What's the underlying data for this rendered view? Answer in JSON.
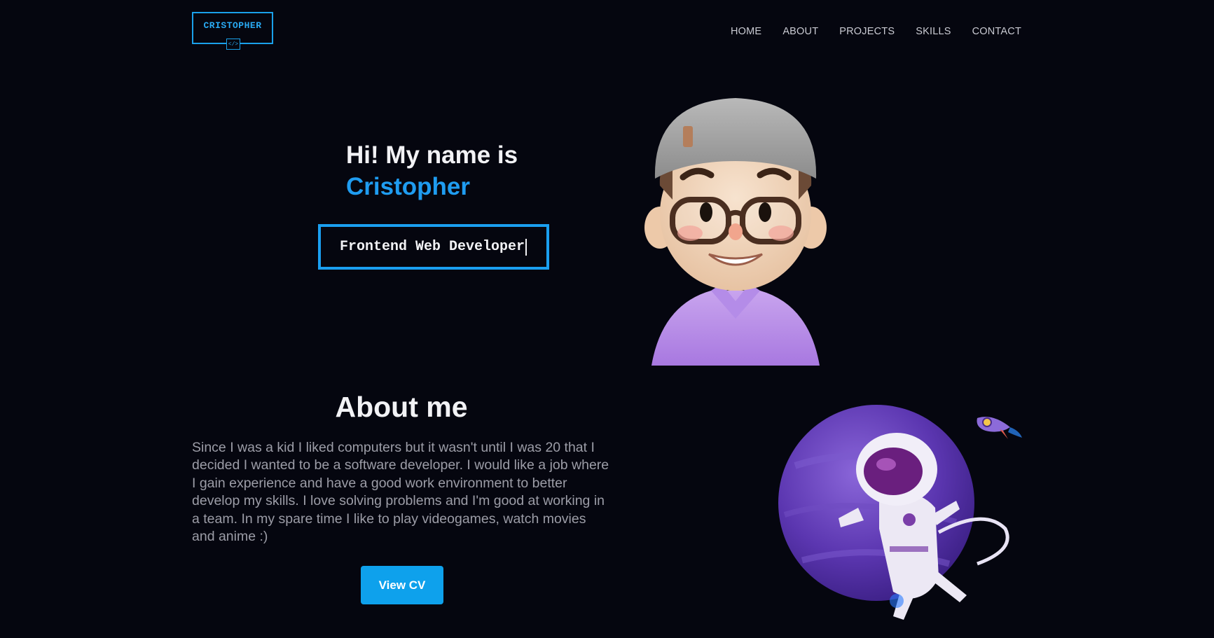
{
  "nav": {
    "logo_text": "CRISTOPHER",
    "logo_code": "</>",
    "links": [
      "HOME",
      "ABOUT",
      "PROJECTS",
      "SKILLS",
      "CONTACT"
    ]
  },
  "hero": {
    "greeting": "Hi! My name is",
    "name": "Cristopher",
    "role": "Frontend Web Developer"
  },
  "about": {
    "title": "About me",
    "text": "Since I was a kid I liked computers but it wasn't until I was 20 that I decided I wanted to be a software developer. I would like a job where I gain experience and have a good work environment to better develop my skills. I love solving problems and I'm good at working in a team. In my spare time I like to play videogames, watch movies and anime :)",
    "button_label": "View CV"
  },
  "colors": {
    "background": "#05060f",
    "accent": "#1f9cf0",
    "button": "#0ea1ec",
    "body_text": "#9c9da7"
  },
  "icons": [
    "code-icon",
    "avatar-illustration",
    "astronaut-planet-illustration",
    "rocket-icon"
  ]
}
